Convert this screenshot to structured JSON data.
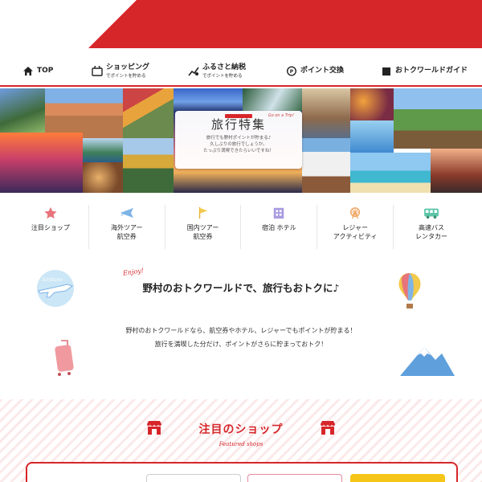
{
  "nav": {
    "items": [
      {
        "label": "TOP",
        "sub": "",
        "icon": "home-icon"
      },
      {
        "label": "ショッピング",
        "sub": "でポイントを貯める",
        "icon": "shopping-bag-icon"
      },
      {
        "label": "ふるさと納税",
        "sub": "でポイントを貯める",
        "icon": "hometown-tax-icon"
      },
      {
        "label": "ポイント交換",
        "sub": "",
        "icon": "point-exchange-icon"
      },
      {
        "label": "おトクワールドガイド",
        "sub": "",
        "icon": "guide-book-icon"
      }
    ]
  },
  "banner": {
    "title": "旅行特集",
    "tag": "Go on a Trip!",
    "sub_lines": [
      "旅行でも野村ポイントが貯まる♪",
      "久しぶりの旅行でしょうか。",
      "たっぷり満喫できたらいいですね！"
    ]
  },
  "categories": [
    {
      "label": "注目ショップ",
      "icon": "star-icon",
      "color": "#e8737a"
    },
    {
      "label": "海外ツアー\n航空券",
      "icon": "airplane-icon",
      "color": "#7fb4e6"
    },
    {
      "label": "国内ツアー\n航空券",
      "icon": "flag-icon",
      "color": "#f2c94c"
    },
    {
      "label": "宿泊 ホテル",
      "icon": "hotel-icon",
      "color": "#a99be0"
    },
    {
      "label": "レジャー\nアクティビティ",
      "icon": "ferris-wheel-icon",
      "color": "#f2a562"
    },
    {
      "label": "高速バス\nレンタカー",
      "icon": "bus-icon",
      "color": "#5cc6a6"
    }
  ],
  "intro": {
    "enjoy": "Enjoy!",
    "title": "野村のおトクワールドで、旅行もおトクに♪",
    "body_line1": "野村のおトクワールドなら、航空券やホテル、レジャーでもポイントが貯まる！",
    "body_line2": "旅行を満喫した分だけ、ポイントがさらに貯まっておトク！",
    "sticker_text": "Airplane"
  },
  "featured": {
    "title": "注目のショップ",
    "sub": "Featured shops"
  },
  "colors": {
    "accent": "#d7262a"
  }
}
